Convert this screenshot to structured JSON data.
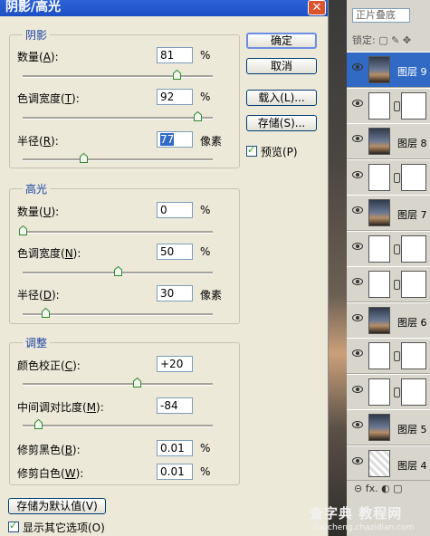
{
  "dialog": {
    "title": "阴影/高光",
    "close": "✕",
    "shadows": {
      "title": "阴影",
      "amount": {
        "label_pre": "数量(",
        "key": "A",
        "label_post": "):",
        "value": "81",
        "unit": "%",
        "level": 0.81
      },
      "tonal_width": {
        "label_pre": "色调宽度(",
        "key": "T",
        "label_post": "):",
        "value": "92",
        "unit": "%",
        "level": 0.92
      },
      "radius": {
        "label_pre": "半径(",
        "key": "R",
        "label_post": "):",
        "value": "77",
        "unit": "像素",
        "level": 0.32
      }
    },
    "highlights": {
      "title": "高光",
      "amount": {
        "label_pre": "数量(",
        "key": "U",
        "label_post": "):",
        "value": "0",
        "unit": "%",
        "level": 0.0
      },
      "tonal_width": {
        "label_pre": "色调宽度(",
        "key": "N",
        "label_post": "):",
        "value": "50",
        "unit": "%",
        "level": 0.5
      },
      "radius": {
        "label_pre": "半径(",
        "key": "D",
        "label_post": "):",
        "value": "30",
        "unit": "像素",
        "level": 0.12
      }
    },
    "adjustments": {
      "title": "调整",
      "color_correction": {
        "label_pre": "颜色校正(",
        "key": "C",
        "label_post": "):",
        "value": "+20",
        "level": 0.6
      },
      "midtone_contrast": {
        "label_pre": "中间调对比度(",
        "key": "M",
        "label_post": "):",
        "value": "-84",
        "level": 0.08
      },
      "black_clip": {
        "label_pre": "修剪黑色(",
        "key": "B",
        "label_post": "):",
        "value": "0.01",
        "unit": "%"
      },
      "white_clip": {
        "label_pre": "修剪白色(",
        "key": "W",
        "label_post": "):",
        "value": "0.01",
        "unit": "%"
      }
    },
    "buttons": {
      "ok": "确定",
      "cancel": "取消",
      "load": "载入(L)...",
      "save": "存储(S)...",
      "preview": "预览(P)",
      "save_default": "存储为默认值(V)",
      "show_more": "显示其它选项(O)"
    }
  },
  "layers_panel": {
    "blend_mode": "正片叠底",
    "lock_label": "锁定:",
    "lock_icons": "▢ ✎ ✥",
    "layers": [
      {
        "name": "图层 9",
        "thumb": "photo",
        "active": true
      },
      {
        "name": "",
        "thumb": "mask",
        "mask": true
      },
      {
        "name": "图层 8",
        "thumb": "photo"
      },
      {
        "name": "",
        "thumb": "mask",
        "mask": true
      },
      {
        "name": "图层 7",
        "thumb": "photo"
      },
      {
        "name": "",
        "thumb": "mask",
        "mask": true
      },
      {
        "name": "",
        "thumb": "mask",
        "mask": true
      },
      {
        "name": "图层 6",
        "thumb": "photo"
      },
      {
        "name": "",
        "thumb": "mask",
        "mask": true
      },
      {
        "name": "",
        "thumb": "mask",
        "mask": true
      },
      {
        "name": "图层 5",
        "thumb": "photo"
      },
      {
        "name": "图层 4",
        "thumb": "check"
      }
    ],
    "footer_icons": "⊝ fx. ◐ ▢"
  },
  "watermark": {
    "main": "查字典 教程网",
    "url": "jiaocheng.chazidian.com"
  },
  "colors": {
    "accent": "#316ac5",
    "title_bar": "#2d63d8",
    "group_title": "#1d44a6"
  }
}
